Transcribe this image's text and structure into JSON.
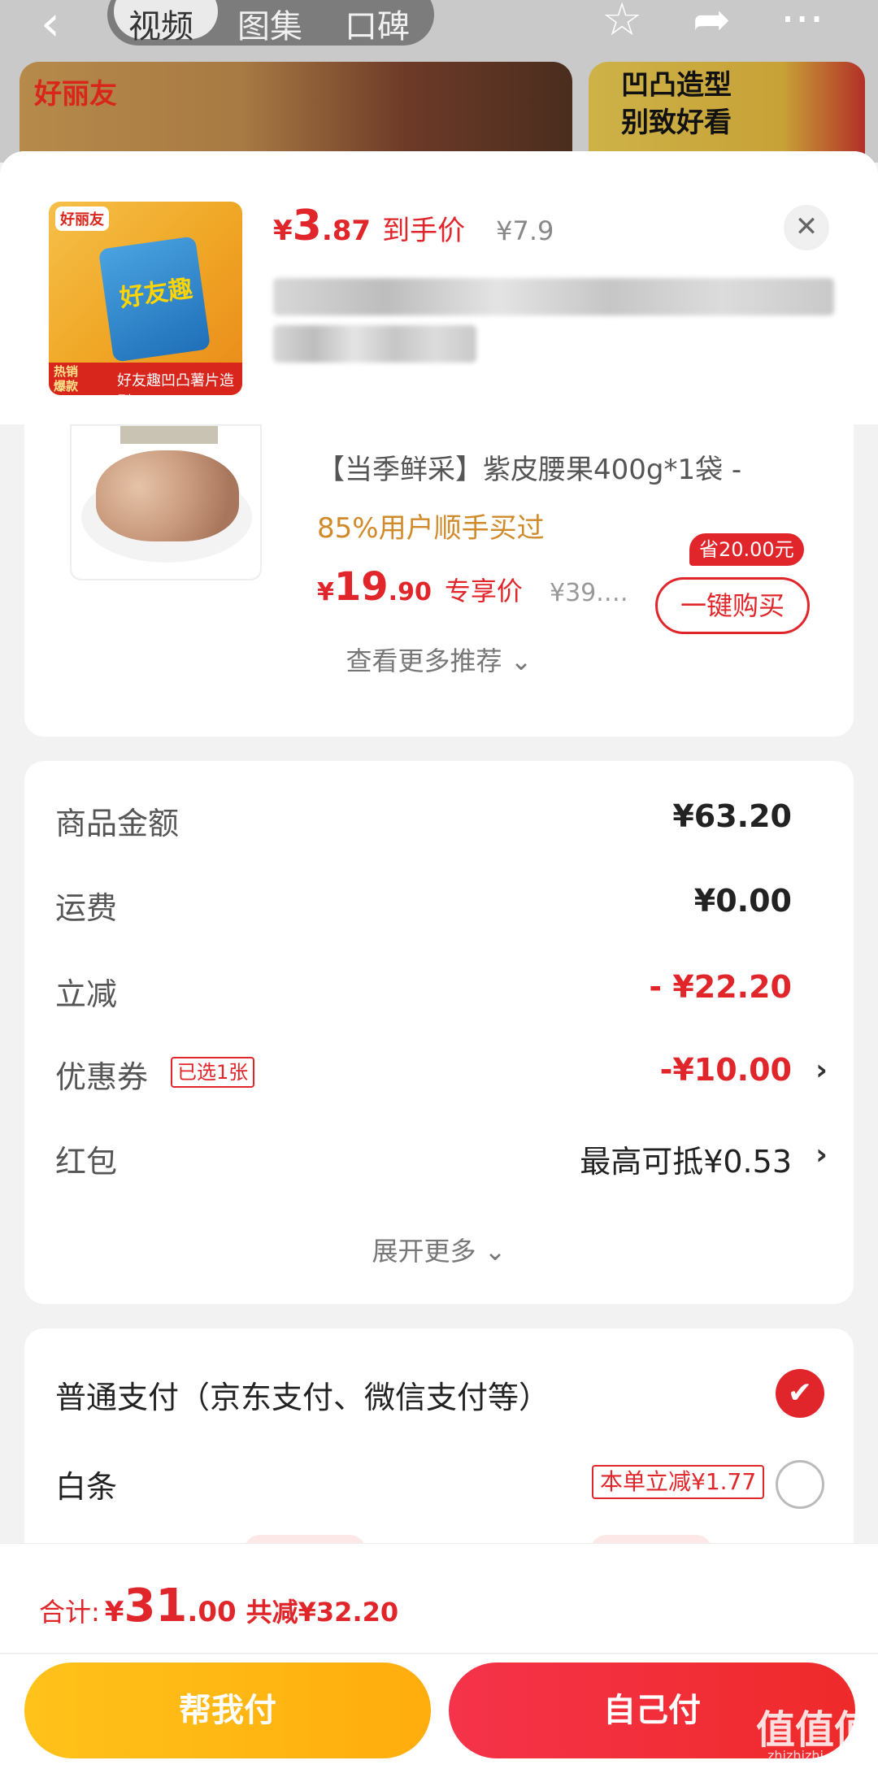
{
  "background": {
    "tabs": [
      "视频",
      "图集",
      "口碑"
    ],
    "banner_brand": "好丽友",
    "banner2_text": "凹凸造型\n别致好看"
  },
  "product": {
    "thumb_brand": "好丽友",
    "thumb_bag_text": "好友趣",
    "thumb_badge_left": "热销\n爆款",
    "thumb_badge_right": "好友趣凹凸薯片造型",
    "price_currency": "¥",
    "price_int": "3",
    "price_dec": ".87",
    "price_tag": "到手价",
    "original_price": "¥7.9",
    "close_icon": "close-icon"
  },
  "recommendation": {
    "title": "【当季鲜采】紫皮腰果400g*1袋 -",
    "subtitle": "85%用户顺手买过",
    "price_currency": "¥",
    "price_int": "19",
    "price_dec": ".90",
    "price_tag": "专享价",
    "original_price": "¥39.…",
    "save_badge": "省20.00元",
    "buy_label": "一键购买",
    "more_label": "查看更多推荐 ⌄"
  },
  "summary": {
    "rows": [
      {
        "label": "商品金额",
        "value": "¥63.20"
      },
      {
        "label": "运费",
        "value": "¥0.00"
      },
      {
        "label": "立减",
        "value": "- ¥22.20"
      },
      {
        "label": "优惠券",
        "badge": "已选1张",
        "value": "-¥10.00"
      },
      {
        "label": "红包",
        "value": "最高可抵¥0.53"
      }
    ],
    "expand_label": "展开更多 ⌄"
  },
  "payment": {
    "option1": "普通支付（京东支付、微信支付等）",
    "option2": "白条",
    "option2_promo": "本单立减¥1.77"
  },
  "footer": {
    "total_label": "合计:",
    "total_currency": "¥",
    "total_int": "31",
    "total_dec": ".00",
    "total_saved": "共减¥32.20",
    "btn_help": "帮我付",
    "btn_self": "自己付"
  },
  "watermark": {
    "text": "值值值",
    "sub": "zhizhizhi.com"
  },
  "colors": {
    "accent": "#e0262a",
    "gold": "#ffc21a",
    "orange_text": "#d18a2a"
  }
}
